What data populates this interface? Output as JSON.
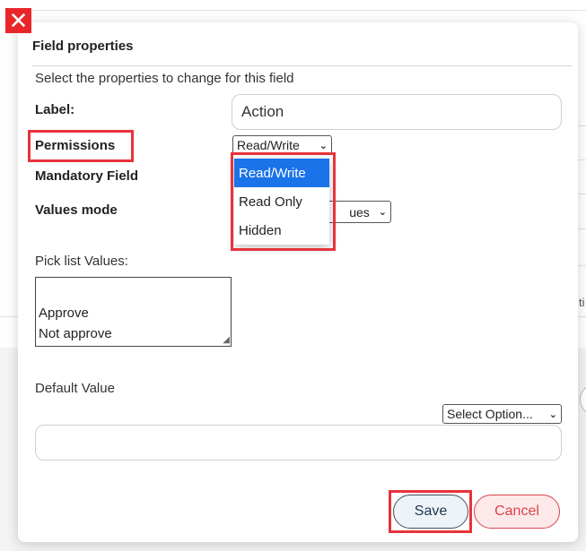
{
  "dialog": {
    "title": "Field properties",
    "intro": "Select the properties to change for this field",
    "label_caption": "Label:",
    "label_value": "Action",
    "permissions_caption": "Permissions",
    "permissions_selected": "Read/Write",
    "permissions_options": [
      "Read/Write",
      "Read Only",
      "Hidden"
    ],
    "mandatory_caption": "Mandatory Field",
    "values_mode_caption": "Values mode",
    "values_mode_visible_text": "ues",
    "picklist_caption": "Pick list Values:",
    "picklist_lines": [
      "Approve",
      "Not approve"
    ],
    "default_value_caption": "Default Value",
    "default_select_label": "Select Option...",
    "default_value": "",
    "save_label": "Save",
    "cancel_label": "Cancel"
  },
  "icons": {
    "close": "close-icon",
    "chevron": "chevron-down-icon",
    "resize": "resize-handle-icon"
  },
  "colors": {
    "close_bg": "#e8262a",
    "highlight": "#e8333b",
    "dropdown_selected": "#1a73e8",
    "cancel": "#d9434a"
  },
  "background": {
    "fragment_text": "ti"
  }
}
